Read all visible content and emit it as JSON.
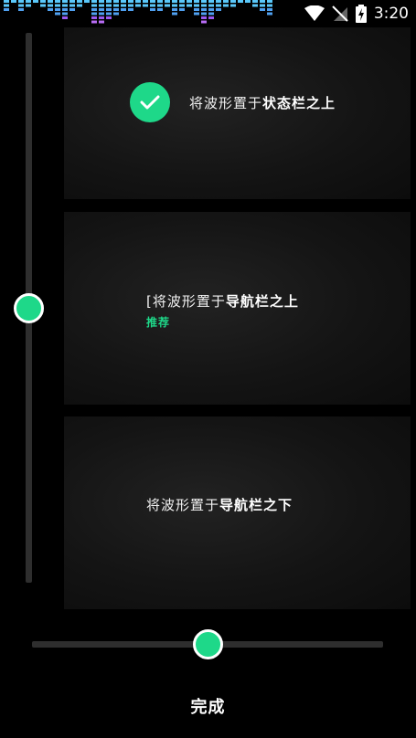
{
  "status_bar": {
    "time": "3:20",
    "icons": [
      "wifi-icon",
      "no-signal-icon",
      "battery-charging-icon"
    ]
  },
  "visualizer": {
    "colors": [
      "#5ac8fa",
      "#4fa0f0",
      "#9b59f0",
      "#b86cf5"
    ]
  },
  "options": [
    {
      "prefix": "将波形置于",
      "emphasis": "状态栏之上",
      "selected": true,
      "badge": ""
    },
    {
      "prefix": "[将波形置于",
      "emphasis": "导航栏之上",
      "selected": false,
      "badge": "推荐"
    },
    {
      "prefix": "将波形置于",
      "emphasis": "导航栏之下",
      "selected": false,
      "badge": ""
    }
  ],
  "vertical_slider": {
    "value_fraction": 0.5
  },
  "horizontal_slider": {
    "value_fraction": 0.5
  },
  "done_label": "完成",
  "accent_color": "#1ed889"
}
